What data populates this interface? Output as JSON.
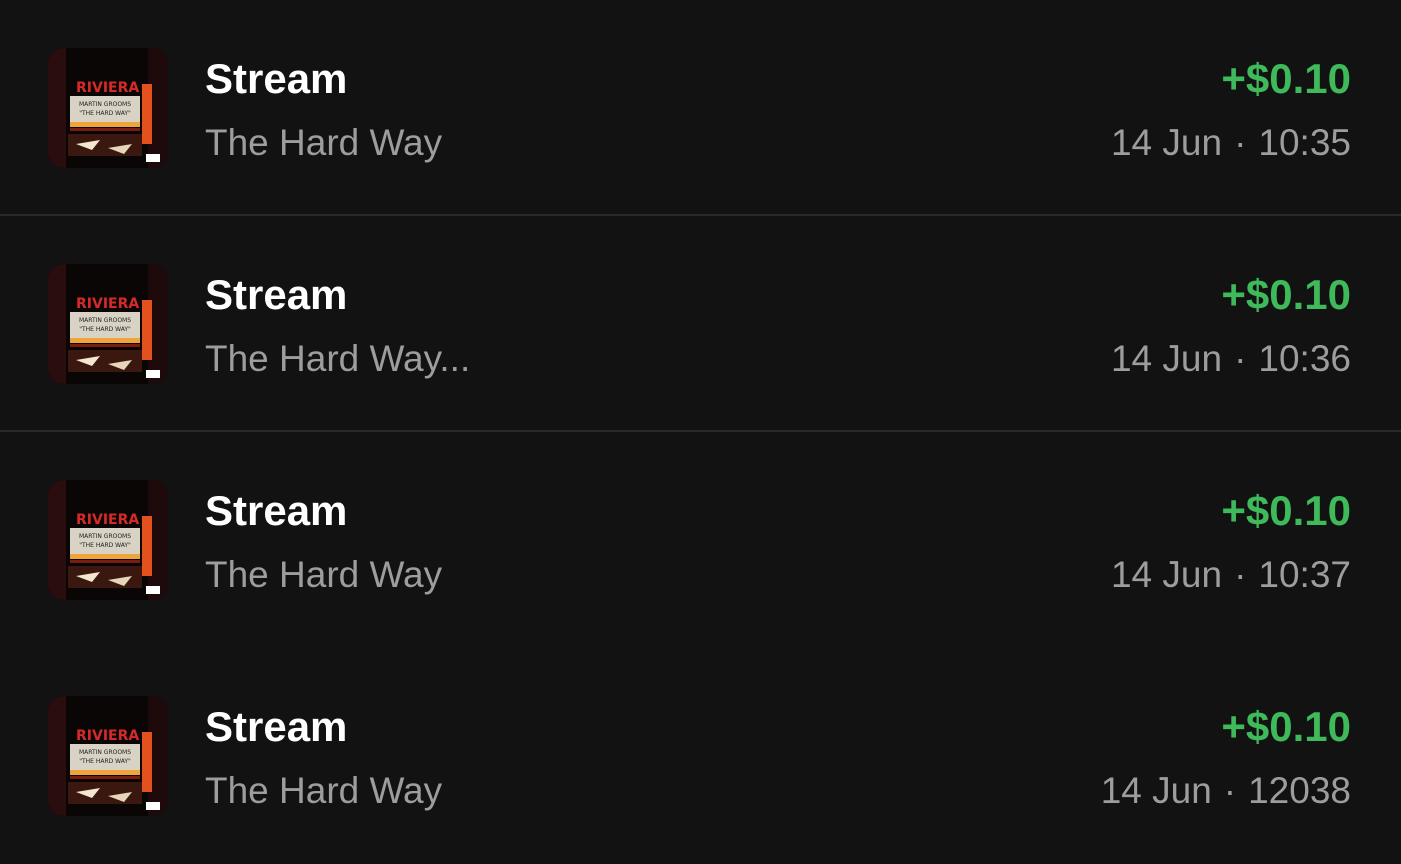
{
  "transactions": [
    {
      "title": "Stream",
      "subtitle": "The Hard Way",
      "amount": "+$0.10",
      "date": "14 Jun",
      "separator": "·",
      "time": "10:35"
    },
    {
      "title": "Stream",
      "subtitle": "The Hard Way...",
      "amount": "+$0.10",
      "date": "14 Jun",
      "separator": "·",
      "time": "10:36"
    },
    {
      "title": "Stream",
      "subtitle": "The Hard Way",
      "amount": "+$0.10",
      "date": "14 Jun",
      "separator": "·",
      "time": "10:37"
    },
    {
      "title": "Stream",
      "subtitle": "The Hard Way",
      "amount": "+$0.10",
      "date": "14 Jun",
      "separator": "·",
      "time": "12038"
    }
  ],
  "album_art": {
    "marquee_sign": "RIVIERA",
    "line1": "MARTIN GROOMS",
    "line2": "\"THE HARD WAY\""
  },
  "colors": {
    "background": "#121212",
    "amount_positive": "#3fba5a",
    "secondary_text": "#9d9d9d",
    "divider": "#2a2a2a"
  }
}
